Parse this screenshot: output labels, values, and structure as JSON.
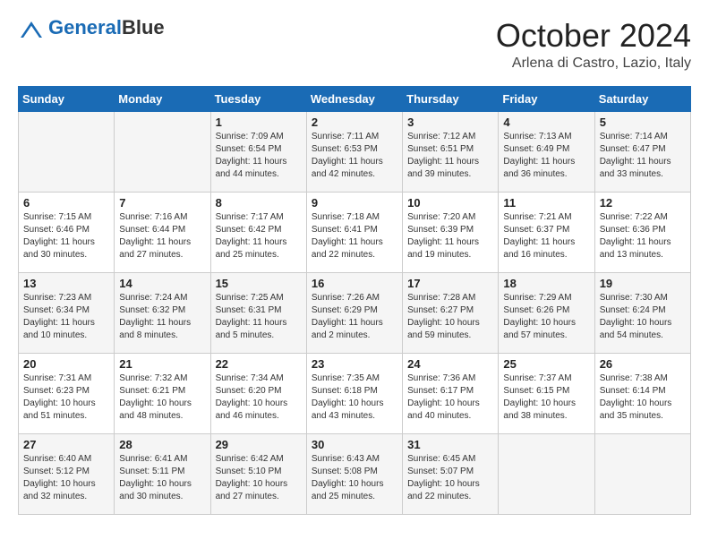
{
  "logo": {
    "part1": "General",
    "part2": "Blue"
  },
  "title": {
    "month": "October 2024",
    "location": "Arlena di Castro, Lazio, Italy"
  },
  "weekdays": [
    "Sunday",
    "Monday",
    "Tuesday",
    "Wednesday",
    "Thursday",
    "Friday",
    "Saturday"
  ],
  "weeks": [
    [
      {
        "day": "",
        "info": ""
      },
      {
        "day": "",
        "info": ""
      },
      {
        "day": "1",
        "info": "Sunrise: 7:09 AM\nSunset: 6:54 PM\nDaylight: 11 hours and 44 minutes."
      },
      {
        "day": "2",
        "info": "Sunrise: 7:11 AM\nSunset: 6:53 PM\nDaylight: 11 hours and 42 minutes."
      },
      {
        "day": "3",
        "info": "Sunrise: 7:12 AM\nSunset: 6:51 PM\nDaylight: 11 hours and 39 minutes."
      },
      {
        "day": "4",
        "info": "Sunrise: 7:13 AM\nSunset: 6:49 PM\nDaylight: 11 hours and 36 minutes."
      },
      {
        "day": "5",
        "info": "Sunrise: 7:14 AM\nSunset: 6:47 PM\nDaylight: 11 hours and 33 minutes."
      }
    ],
    [
      {
        "day": "6",
        "info": "Sunrise: 7:15 AM\nSunset: 6:46 PM\nDaylight: 11 hours and 30 minutes."
      },
      {
        "day": "7",
        "info": "Sunrise: 7:16 AM\nSunset: 6:44 PM\nDaylight: 11 hours and 27 minutes."
      },
      {
        "day": "8",
        "info": "Sunrise: 7:17 AM\nSunset: 6:42 PM\nDaylight: 11 hours and 25 minutes."
      },
      {
        "day": "9",
        "info": "Sunrise: 7:18 AM\nSunset: 6:41 PM\nDaylight: 11 hours and 22 minutes."
      },
      {
        "day": "10",
        "info": "Sunrise: 7:20 AM\nSunset: 6:39 PM\nDaylight: 11 hours and 19 minutes."
      },
      {
        "day": "11",
        "info": "Sunrise: 7:21 AM\nSunset: 6:37 PM\nDaylight: 11 hours and 16 minutes."
      },
      {
        "day": "12",
        "info": "Sunrise: 7:22 AM\nSunset: 6:36 PM\nDaylight: 11 hours and 13 minutes."
      }
    ],
    [
      {
        "day": "13",
        "info": "Sunrise: 7:23 AM\nSunset: 6:34 PM\nDaylight: 11 hours and 10 minutes."
      },
      {
        "day": "14",
        "info": "Sunrise: 7:24 AM\nSunset: 6:32 PM\nDaylight: 11 hours and 8 minutes."
      },
      {
        "day": "15",
        "info": "Sunrise: 7:25 AM\nSunset: 6:31 PM\nDaylight: 11 hours and 5 minutes."
      },
      {
        "day": "16",
        "info": "Sunrise: 7:26 AM\nSunset: 6:29 PM\nDaylight: 11 hours and 2 minutes."
      },
      {
        "day": "17",
        "info": "Sunrise: 7:28 AM\nSunset: 6:27 PM\nDaylight: 10 hours and 59 minutes."
      },
      {
        "day": "18",
        "info": "Sunrise: 7:29 AM\nSunset: 6:26 PM\nDaylight: 10 hours and 57 minutes."
      },
      {
        "day": "19",
        "info": "Sunrise: 7:30 AM\nSunset: 6:24 PM\nDaylight: 10 hours and 54 minutes."
      }
    ],
    [
      {
        "day": "20",
        "info": "Sunrise: 7:31 AM\nSunset: 6:23 PM\nDaylight: 10 hours and 51 minutes."
      },
      {
        "day": "21",
        "info": "Sunrise: 7:32 AM\nSunset: 6:21 PM\nDaylight: 10 hours and 48 minutes."
      },
      {
        "day": "22",
        "info": "Sunrise: 7:34 AM\nSunset: 6:20 PM\nDaylight: 10 hours and 46 minutes."
      },
      {
        "day": "23",
        "info": "Sunrise: 7:35 AM\nSunset: 6:18 PM\nDaylight: 10 hours and 43 minutes."
      },
      {
        "day": "24",
        "info": "Sunrise: 7:36 AM\nSunset: 6:17 PM\nDaylight: 10 hours and 40 minutes."
      },
      {
        "day": "25",
        "info": "Sunrise: 7:37 AM\nSunset: 6:15 PM\nDaylight: 10 hours and 38 minutes."
      },
      {
        "day": "26",
        "info": "Sunrise: 7:38 AM\nSunset: 6:14 PM\nDaylight: 10 hours and 35 minutes."
      }
    ],
    [
      {
        "day": "27",
        "info": "Sunrise: 6:40 AM\nSunset: 5:12 PM\nDaylight: 10 hours and 32 minutes."
      },
      {
        "day": "28",
        "info": "Sunrise: 6:41 AM\nSunset: 5:11 PM\nDaylight: 10 hours and 30 minutes."
      },
      {
        "day": "29",
        "info": "Sunrise: 6:42 AM\nSunset: 5:10 PM\nDaylight: 10 hours and 27 minutes."
      },
      {
        "day": "30",
        "info": "Sunrise: 6:43 AM\nSunset: 5:08 PM\nDaylight: 10 hours and 25 minutes."
      },
      {
        "day": "31",
        "info": "Sunrise: 6:45 AM\nSunset: 5:07 PM\nDaylight: 10 hours and 22 minutes."
      },
      {
        "day": "",
        "info": ""
      },
      {
        "day": "",
        "info": ""
      }
    ]
  ]
}
